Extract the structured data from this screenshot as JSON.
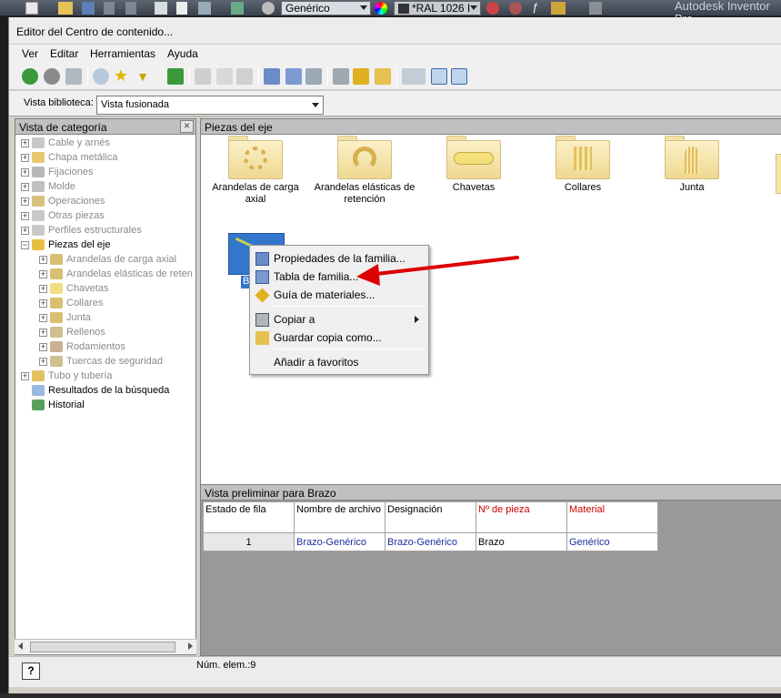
{
  "topbar": {
    "style_dropdown": "Genérico",
    "color_dropdown": "*RAL 1026 I",
    "app_title": "Autodesk Inventor Pro"
  },
  "window": {
    "title": "Editor del Centro de contenido..."
  },
  "menu": [
    "Ver",
    "Editar",
    "Herramientas",
    "Ayuda"
  ],
  "library": {
    "label": "Vista biblioteca:",
    "value": "Vista fusionada"
  },
  "category_panel": {
    "title": "Vista de categoría",
    "close_glyph": "×",
    "items": [
      {
        "label": "Cable y arnés",
        "level": 0,
        "expander": "+",
        "dim": true,
        "icon": "cable-icon"
      },
      {
        "label": "Chapa metálica",
        "level": 0,
        "expander": "+",
        "dim": true,
        "icon": "sheet-metal-icon"
      },
      {
        "label": "Fijaciones",
        "level": 0,
        "expander": "+",
        "dim": true,
        "icon": "fastener-icon"
      },
      {
        "label": "Molde",
        "level": 0,
        "expander": "+",
        "dim": true,
        "icon": "mold-icon"
      },
      {
        "label": "Operaciones",
        "level": 0,
        "expander": "+",
        "dim": true,
        "icon": "feature-icon"
      },
      {
        "label": "Otras piezas",
        "level": 0,
        "expander": "+",
        "dim": true,
        "icon": "other-parts-icon"
      },
      {
        "label": "Perfiles estructurales",
        "level": 0,
        "expander": "+",
        "dim": true,
        "icon": "profile-icon"
      },
      {
        "label": "Piezas del eje",
        "level": 0,
        "expander": "−",
        "dim": false,
        "icon": "shaft-parts-icon"
      },
      {
        "label": "Arandelas de carga axial",
        "level": 1,
        "expander": "+",
        "dim": true,
        "icon": "washer-icon"
      },
      {
        "label": "Arandelas elásticas de reten",
        "level": 1,
        "expander": "+",
        "dim": true,
        "icon": "retaining-ring-icon"
      },
      {
        "label": "Chavetas",
        "level": 1,
        "expander": "+",
        "dim": true,
        "icon": "key-icon"
      },
      {
        "label": "Collares",
        "level": 1,
        "expander": "+",
        "dim": true,
        "icon": "collar-icon"
      },
      {
        "label": "Junta",
        "level": 1,
        "expander": "+",
        "dim": true,
        "icon": "seal-icon"
      },
      {
        "label": "Rellenos",
        "level": 1,
        "expander": "+",
        "dim": true,
        "icon": "filler-icon"
      },
      {
        "label": "Rodamientos",
        "level": 1,
        "expander": "+",
        "dim": true,
        "icon": "bearing-icon"
      },
      {
        "label": "Tuercas de seguridad",
        "level": 1,
        "expander": "+",
        "dim": true,
        "icon": "locknut-icon"
      },
      {
        "label": "Tubo y tubería",
        "level": 0,
        "expander": "+",
        "dim": true,
        "icon": "tube-icon"
      },
      {
        "label": "Resultados de la búsqueda",
        "level": 0,
        "expander": "",
        "dim": false,
        "icon": "search-results-icon"
      },
      {
        "label": "Historial",
        "level": 0,
        "expander": "",
        "dim": false,
        "icon": "history-icon"
      }
    ]
  },
  "families_panel": {
    "title": "Piezas del eje",
    "families": [
      {
        "label": "Arandelas de carga axial"
      },
      {
        "label": "Arandelas elásticas de retención"
      },
      {
        "label": "Chavetas"
      },
      {
        "label": "Collares"
      },
      {
        "label": "Junta"
      }
    ],
    "selected_item_label": "Br"
  },
  "context_menu": {
    "items": [
      {
        "label": "Propiedades de la familia...",
        "icon": "family-properties-icon"
      },
      {
        "label": "Tabla de familia...",
        "icon": "family-table-icon"
      },
      {
        "label": "Guía de materiales...",
        "icon": "material-guide-icon"
      },
      {
        "label": "Copiar a",
        "icon": "copy-to-icon",
        "submenu": true
      },
      {
        "label": "Guardar copia como...",
        "icon": "save-copy-icon"
      },
      {
        "label": "Añadir a favoritos",
        "icon": ""
      }
    ]
  },
  "preview": {
    "title": "Vista preliminar para Brazo",
    "columns": [
      {
        "label": "Estado de fila",
        "color": "#000000"
      },
      {
        "label": "Nombre de archivo",
        "color": "#000000"
      },
      {
        "label": "Designación",
        "color": "#000000"
      },
      {
        "label": "Nº de pieza",
        "color": "#cc0000"
      },
      {
        "label": "Material",
        "color": "#cc0000"
      }
    ],
    "rows": [
      [
        "1",
        "Brazo-Genérico",
        "Brazo-Genérico",
        "Brazo",
        "Genérico"
      ]
    ]
  },
  "status": {
    "help": "?",
    "count_text": "Núm. elem.:9"
  },
  "colors": {
    "accent_selection": "#3377cc",
    "annotation_arrow": "#dd0000"
  }
}
